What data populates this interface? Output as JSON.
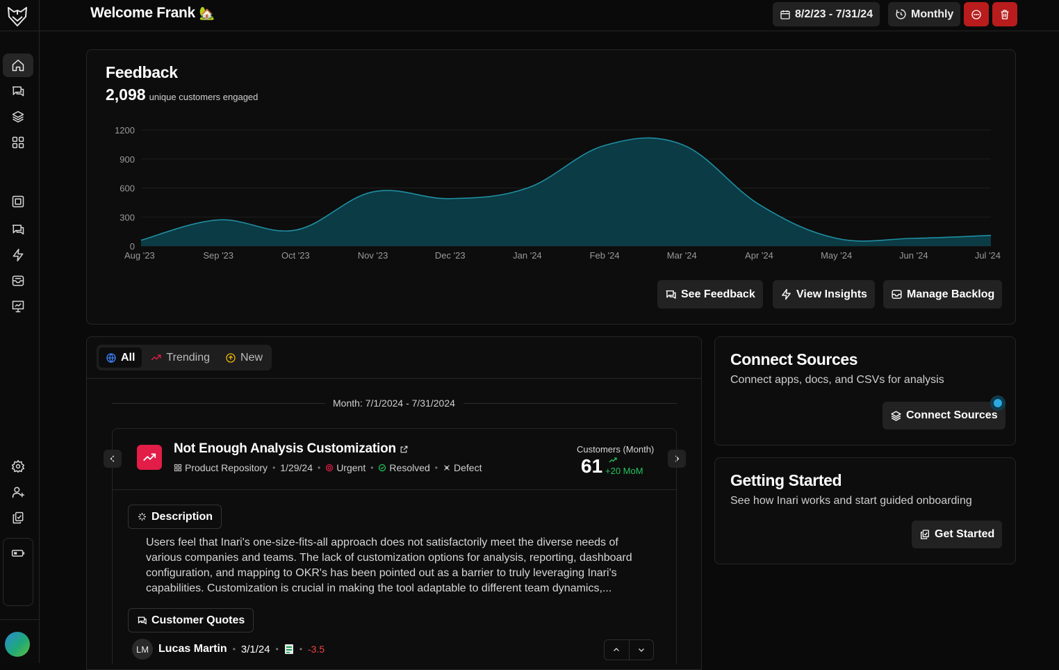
{
  "header": {
    "welcome": "Welcome Frank",
    "welcome_emoji": "🏡",
    "date_range": "8/2/23 - 7/31/24",
    "period": "Monthly"
  },
  "feedback": {
    "title": "Feedback",
    "count": "2,098",
    "count_label": "unique customers engaged",
    "buttons": {
      "see_feedback": "See Feedback",
      "view_insights": "View Insights",
      "manage_backlog": "Manage Backlog"
    }
  },
  "chart_data": {
    "type": "area",
    "categories": [
      "Aug '23",
      "Sep '23",
      "Oct '23",
      "Nov '23",
      "Dec '23",
      "Jan '24",
      "Feb '24",
      "Mar '24",
      "Apr '24",
      "May '24",
      "Jun '24",
      "Jul '24"
    ],
    "values": [
      60,
      270,
      165,
      560,
      490,
      600,
      1040,
      1050,
      430,
      80,
      80,
      110
    ],
    "yticks": [
      "0",
      "300",
      "600",
      "900",
      "1200"
    ],
    "ylim": [
      0,
      1200
    ],
    "grid": true,
    "fill_color": "#0b3b44",
    "line_color": "#1f8ea3"
  },
  "feed": {
    "tabs": [
      "All",
      "Trending",
      "New"
    ],
    "month_label": "Month: 7/1/2024 - 7/31/2024",
    "insight": {
      "title": "Not Enough Analysis Customization",
      "repo": "Product Repository",
      "date": "1/29/24",
      "priority": "Urgent",
      "status": "Resolved",
      "type": "Defect",
      "customers_label": "Customers (Month)",
      "customers": "61",
      "mom": "+20 MoM",
      "description_label": "Description",
      "description": "Users feel that Inari's one-size-fits-all approach does not satisfactorily meet the diverse needs of various companies and teams. The lack of customization options for analysis, reporting, dashboard configuration, and mapping to OKR's has been pointed out as a barrier to truly leveraging Inari's capabilities. Customization is crucial in making the tool adaptable to different team dynamics,...",
      "quotes_label": "Customer Quotes",
      "quote": {
        "initials": "LM",
        "name": "Lucas Martin",
        "date": "3/1/24",
        "score": "-3.5"
      }
    }
  },
  "connect": {
    "title": "Connect Sources",
    "subtitle": "Connect apps, docs, and CSVs for analysis",
    "button": "Connect Sources"
  },
  "getting_started": {
    "title": "Getting Started",
    "subtitle": "See how Inari works and start guided onboarding",
    "button": "Get Started"
  }
}
